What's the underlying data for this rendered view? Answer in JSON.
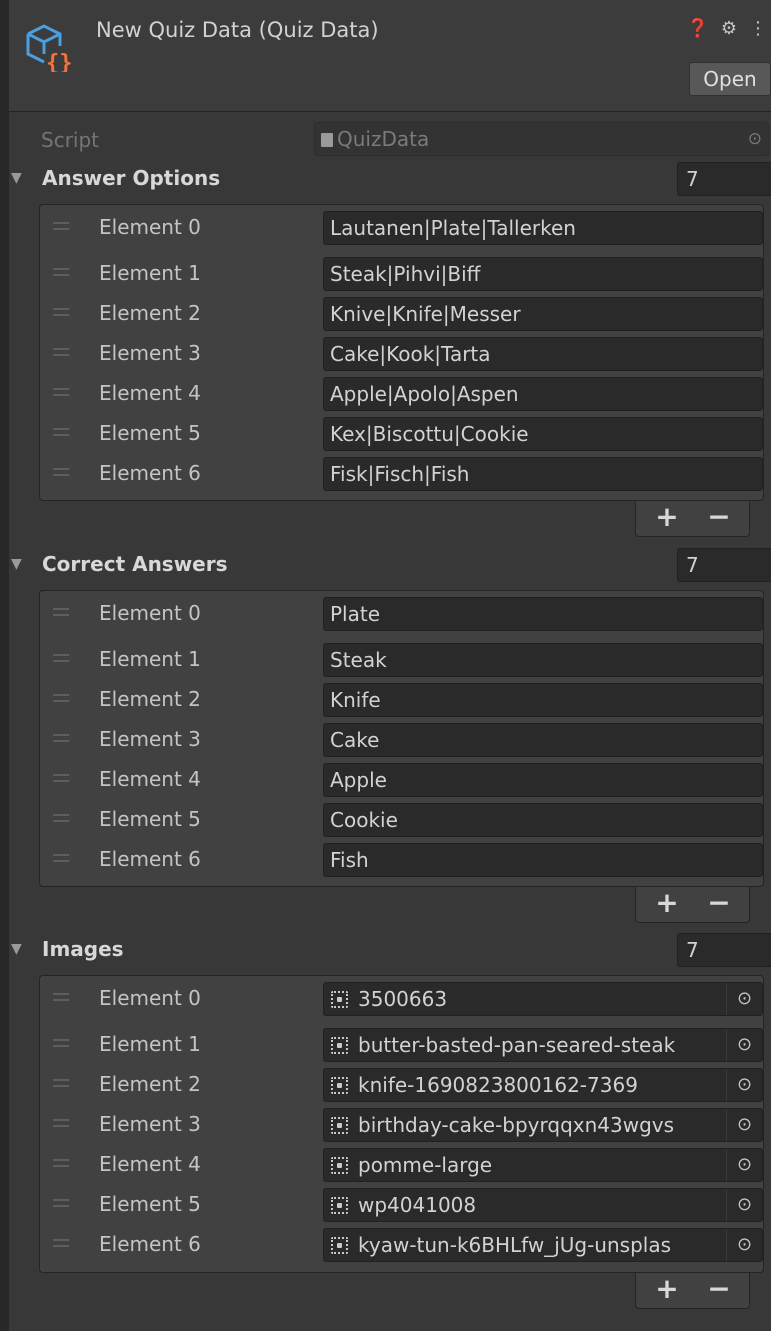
{
  "header": {
    "title": "New Quiz Data (Quiz Data)",
    "icons": [
      "help-icon",
      "settings-icon",
      "more-icon"
    ],
    "open_label": "Open"
  },
  "script": {
    "label": "Script",
    "value": "QuizData"
  },
  "answer_options": {
    "title": "Answer Options",
    "count": "7",
    "elements": [
      {
        "label": "Element 0",
        "value": "Lautanen|Plate|Tallerken"
      },
      {
        "label": "Element 1",
        "value": "Steak|Pihvi|Biff"
      },
      {
        "label": "Element 2",
        "value": "Knive|Knife|Messer"
      },
      {
        "label": "Element 3",
        "value": "Cake|Kook|Tarta"
      },
      {
        "label": "Element 4",
        "value": "Apple|Apolo|Aspen"
      },
      {
        "label": "Element 5",
        "value": "Kex|Biscottu|Cookie"
      },
      {
        "label": "Element 6",
        "value": "Fisk|Fisch|Fish"
      }
    ]
  },
  "correct_answers": {
    "title": "Correct Answers",
    "count": "7",
    "elements": [
      {
        "label": "Element 0",
        "value": "Plate"
      },
      {
        "label": "Element 1",
        "value": "Steak"
      },
      {
        "label": "Element 2",
        "value": "Knife"
      },
      {
        "label": "Element 3",
        "value": "Cake"
      },
      {
        "label": "Element 4",
        "value": "Apple"
      },
      {
        "label": "Element 5",
        "value": "Cookie"
      },
      {
        "label": "Element 6",
        "value": "Fish"
      }
    ]
  },
  "images": {
    "title": "Images",
    "count": "7",
    "elements": [
      {
        "label": "Element 0",
        "value": "3500663"
      },
      {
        "label": "Element 1",
        "value": "butter-basted-pan-seared-steak"
      },
      {
        "label": "Element 2",
        "value": "knife-1690823800162-7369"
      },
      {
        "label": "Element 3",
        "value": "birthday-cake-bpyrqqxn43wgvs"
      },
      {
        "label": "Element 4",
        "value": "pomme-large"
      },
      {
        "label": "Element 5",
        "value": "wp4041008"
      },
      {
        "label": "Element 6",
        "value": "kyaw-tun-k6BHLfw_jUg-unsplas"
      }
    ]
  },
  "list_controls": {
    "plus": "+",
    "minus": "−"
  },
  "colors": {
    "background": "#383838",
    "field": "#2a2a2a",
    "list": "#414141",
    "accent_icon": "#4a9fe0",
    "accent_brace": "#f2743a"
  }
}
